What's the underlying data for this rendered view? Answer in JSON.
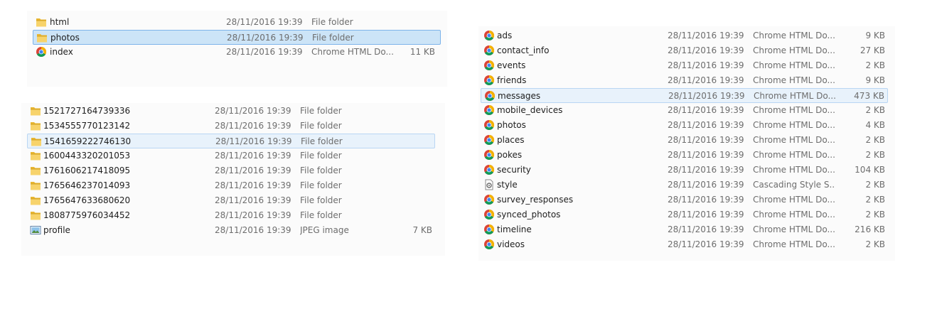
{
  "panel_top": {
    "rows": [
      {
        "icon": "folder-icon",
        "name": "html",
        "date": "28/11/2016 19:39",
        "type": "File folder",
        "size": "",
        "state": ""
      },
      {
        "icon": "folder-icon",
        "name": "photos",
        "date": "28/11/2016 19:39",
        "type": "File folder",
        "size": "",
        "state": "selected"
      },
      {
        "icon": "chrome-icon",
        "name": "index",
        "date": "28/11/2016 19:39",
        "type": "Chrome HTML Do...",
        "size": "11 KB",
        "state": ""
      }
    ]
  },
  "panel_bottom": {
    "rows": [
      {
        "icon": "folder-icon",
        "name": "1521727164739336",
        "date": "28/11/2016 19:39",
        "type": "File folder",
        "size": "",
        "state": ""
      },
      {
        "icon": "folder-icon",
        "name": "1534555770123142",
        "date": "28/11/2016 19:39",
        "type": "File folder",
        "size": "",
        "state": ""
      },
      {
        "icon": "folder-icon",
        "name": "1541659222746130",
        "date": "28/11/2016 19:39",
        "type": "File folder",
        "size": "",
        "state": "hover"
      },
      {
        "icon": "folder-icon",
        "name": "1600443320201053",
        "date": "28/11/2016 19:39",
        "type": "File folder",
        "size": "",
        "state": ""
      },
      {
        "icon": "folder-icon",
        "name": "1761606217418095",
        "date": "28/11/2016 19:39",
        "type": "File folder",
        "size": "",
        "state": ""
      },
      {
        "icon": "folder-icon",
        "name": "1765646237014093",
        "date": "28/11/2016 19:39",
        "type": "File folder",
        "size": "",
        "state": ""
      },
      {
        "icon": "folder-icon",
        "name": "1765647633680620",
        "date": "28/11/2016 19:39",
        "type": "File folder",
        "size": "",
        "state": ""
      },
      {
        "icon": "folder-icon",
        "name": "1808775976034452",
        "date": "28/11/2016 19:39",
        "type": "File folder",
        "size": "",
        "state": ""
      },
      {
        "icon": "image-icon",
        "name": "profile",
        "date": "28/11/2016 19:39",
        "type": "JPEG image",
        "size": "7 KB",
        "state": ""
      }
    ]
  },
  "panel_right": {
    "rows": [
      {
        "icon": "chrome-icon",
        "name": "ads",
        "date": "28/11/2016 19:39",
        "type": "Chrome HTML Do...",
        "size": "9 KB",
        "state": ""
      },
      {
        "icon": "chrome-icon",
        "name": "contact_info",
        "date": "28/11/2016 19:39",
        "type": "Chrome HTML Do...",
        "size": "27 KB",
        "state": ""
      },
      {
        "icon": "chrome-icon",
        "name": "events",
        "date": "28/11/2016 19:39",
        "type": "Chrome HTML Do...",
        "size": "2 KB",
        "state": ""
      },
      {
        "icon": "chrome-icon",
        "name": "friends",
        "date": "28/11/2016 19:39",
        "type": "Chrome HTML Do...",
        "size": "9 KB",
        "state": ""
      },
      {
        "icon": "chrome-icon",
        "name": "messages",
        "date": "28/11/2016 19:39",
        "type": "Chrome HTML Do...",
        "size": "473 KB",
        "state": "hover"
      },
      {
        "icon": "chrome-icon",
        "name": "mobile_devices",
        "date": "28/11/2016 19:39",
        "type": "Chrome HTML Do...",
        "size": "2 KB",
        "state": ""
      },
      {
        "icon": "chrome-icon",
        "name": "photos",
        "date": "28/11/2016 19:39",
        "type": "Chrome HTML Do...",
        "size": "4 KB",
        "state": ""
      },
      {
        "icon": "chrome-icon",
        "name": "places",
        "date": "28/11/2016 19:39",
        "type": "Chrome HTML Do...",
        "size": "2 KB",
        "state": ""
      },
      {
        "icon": "chrome-icon",
        "name": "pokes",
        "date": "28/11/2016 19:39",
        "type": "Chrome HTML Do...",
        "size": "2 KB",
        "state": ""
      },
      {
        "icon": "chrome-icon",
        "name": "security",
        "date": "28/11/2016 19:39",
        "type": "Chrome HTML Do...",
        "size": "104 KB",
        "state": ""
      },
      {
        "icon": "css-file-icon",
        "name": "style",
        "date": "28/11/2016 19:39",
        "type": "Cascading Style S...",
        "size": "2 KB",
        "state": ""
      },
      {
        "icon": "chrome-icon",
        "name": "survey_responses",
        "date": "28/11/2016 19:39",
        "type": "Chrome HTML Do...",
        "size": "2 KB",
        "state": ""
      },
      {
        "icon": "chrome-icon",
        "name": "synced_photos",
        "date": "28/11/2016 19:39",
        "type": "Chrome HTML Do...",
        "size": "2 KB",
        "state": ""
      },
      {
        "icon": "chrome-icon",
        "name": "timeline",
        "date": "28/11/2016 19:39",
        "type": "Chrome HTML Do...",
        "size": "216 KB",
        "state": ""
      },
      {
        "icon": "chrome-icon",
        "name": "videos",
        "date": "28/11/2016 19:39",
        "type": "Chrome HTML Do...",
        "size": "2 KB",
        "state": ""
      }
    ]
  }
}
